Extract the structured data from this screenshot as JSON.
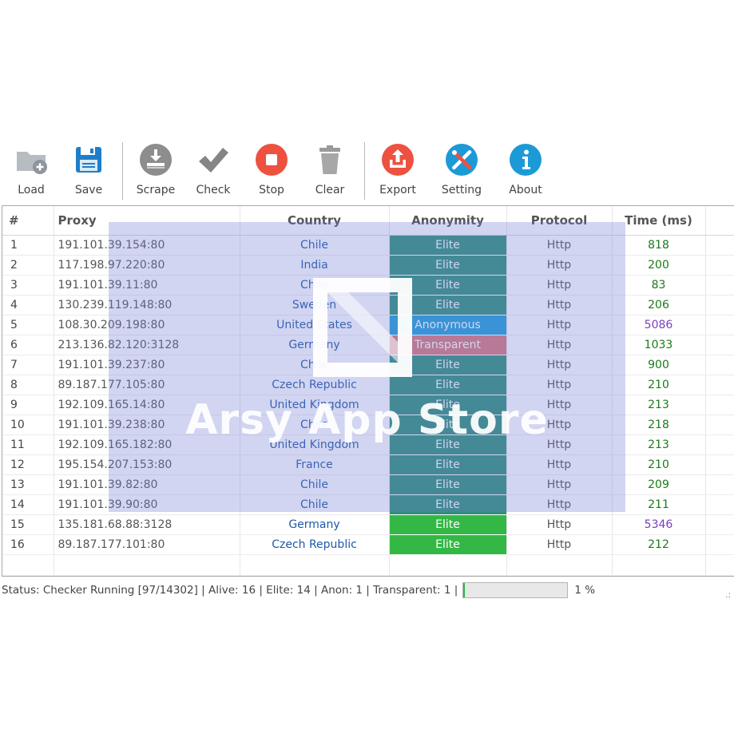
{
  "toolbar": {
    "load": "Load",
    "save": "Save",
    "scrape": "Scrape",
    "check": "Check",
    "stop": "Stop",
    "clear": "Clear",
    "export": "Export",
    "setting": "Setting",
    "about": "About"
  },
  "icons": {
    "load": "folder-add-icon",
    "save": "floppy-disk-icon",
    "scrape": "scrape-icon",
    "check": "checkmark-icon",
    "stop": "stop-icon",
    "clear": "trash-icon",
    "export": "export-icon",
    "setting": "tools-icon",
    "about": "info-icon"
  },
  "colors": {
    "elite_dark": "#2e8f7a",
    "elite_bright": "#33b845",
    "anonymous": "#1e9ed8",
    "transparent": "#d8787a",
    "time_green": "#1a7a1a",
    "time_purple": "#7a3fc2"
  },
  "columns": [
    "#",
    "Proxy",
    "Country",
    "Anonymity",
    "Protocol",
    "Time (ms)"
  ],
  "rows": [
    {
      "idx": "1",
      "proxy": "191.101.39.154:80",
      "country": "Chile",
      "anonymity": "Elite",
      "protocol": "Http",
      "time": "818"
    },
    {
      "idx": "2",
      "proxy": "117.198.97.220:80",
      "country": "India",
      "anonymity": "Elite",
      "protocol": "Http",
      "time": "200"
    },
    {
      "idx": "3",
      "proxy": "191.101.39.11:80",
      "country": "Chile",
      "anonymity": "Elite",
      "protocol": "Http",
      "time": "83"
    },
    {
      "idx": "4",
      "proxy": "130.239.119.148:80",
      "country": "Sweden",
      "anonymity": "Elite",
      "protocol": "Http",
      "time": "206"
    },
    {
      "idx": "5",
      "proxy": "108.30.209.198:80",
      "country": "United States",
      "anonymity": "Anonymous",
      "protocol": "Http",
      "time": "5086"
    },
    {
      "idx": "6",
      "proxy": "213.136.82.120:3128",
      "country": "Germany",
      "anonymity": "Transparent",
      "protocol": "Http",
      "time": "1033"
    },
    {
      "idx": "7",
      "proxy": "191.101.39.237:80",
      "country": "Chile",
      "anonymity": "Elite",
      "protocol": "Http",
      "time": "900"
    },
    {
      "idx": "8",
      "proxy": "89.187.177.105:80",
      "country": "Czech Republic",
      "anonymity": "Elite",
      "protocol": "Http",
      "time": "210"
    },
    {
      "idx": "9",
      "proxy": "192.109.165.14:80",
      "country": "United Kingdom",
      "anonymity": "Elite",
      "protocol": "Http",
      "time": "213"
    },
    {
      "idx": "10",
      "proxy": "191.101.39.238:80",
      "country": "Chile",
      "anonymity": "Elite",
      "protocol": "Http",
      "time": "218"
    },
    {
      "idx": "11",
      "proxy": "192.109.165.182:80",
      "country": "United Kingdom",
      "anonymity": "Elite",
      "protocol": "Http",
      "time": "213"
    },
    {
      "idx": "12",
      "proxy": "195.154.207.153:80",
      "country": "France",
      "anonymity": "Elite",
      "protocol": "Http",
      "time": "210"
    },
    {
      "idx": "13",
      "proxy": "191.101.39.82:80",
      "country": "Chile",
      "anonymity": "Elite",
      "protocol": "Http",
      "time": "209"
    },
    {
      "idx": "14",
      "proxy": "191.101.39.90:80",
      "country": "Chile",
      "anonymity": "Elite",
      "protocol": "Http",
      "time": "211"
    },
    {
      "idx": "15",
      "proxy": "135.181.68.88:3128",
      "country": "Germany",
      "anonymity": "Elite",
      "protocol": "Http",
      "time": "5346"
    },
    {
      "idx": "16",
      "proxy": "89.187.177.101:80",
      "country": "Czech Republic",
      "anonymity": "Elite",
      "protocol": "Http",
      "time": "212"
    }
  ],
  "status": {
    "text": "Status: Checker Running [97/14302] | Alive: 16 | Elite: 14 | Anon: 1 | Transparent: 1 |",
    "progress_percent": 1,
    "progress_label": "1 %"
  },
  "watermark": {
    "text": "Arsy App Store"
  }
}
